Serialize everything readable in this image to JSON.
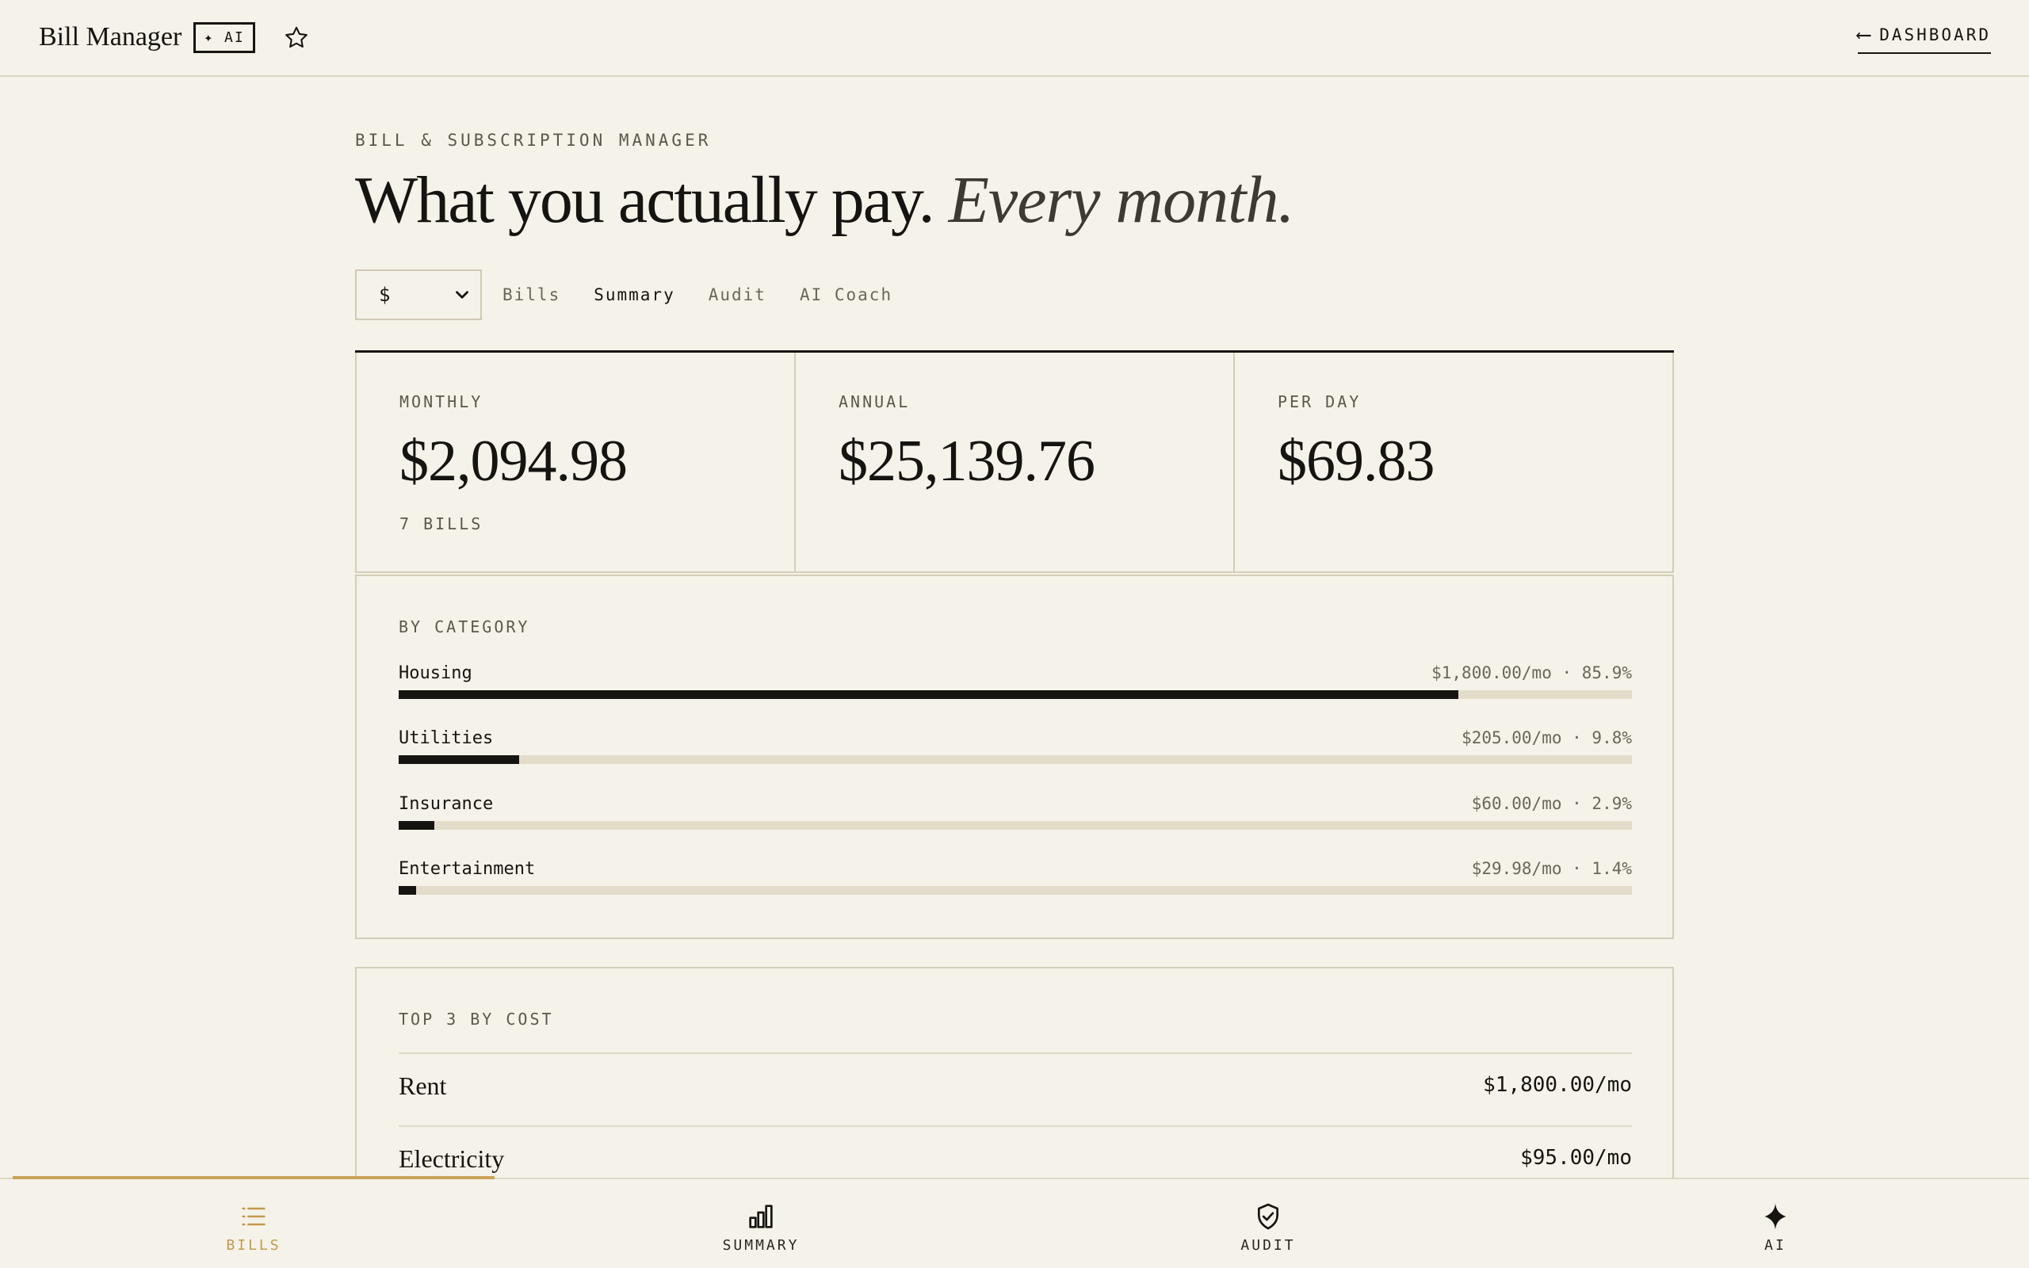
{
  "header": {
    "app_title": "Bill Manager",
    "ai_badge": "✦ AI",
    "dashboard_link": "DASHBOARD",
    "dashboard_arrow": "⟵"
  },
  "hero": {
    "eyebrow": "BILL & SUBSCRIPTION MANAGER",
    "headline_main": "What you actually pay.",
    "headline_italic": "Every month."
  },
  "controls": {
    "currency_selected": "$",
    "tabs": [
      {
        "label": "Bills",
        "active": false
      },
      {
        "label": "Summary",
        "active": true
      },
      {
        "label": "Audit",
        "active": false
      },
      {
        "label": "AI Coach",
        "active": false
      }
    ]
  },
  "stats": {
    "monthly": {
      "label": "MONTHLY",
      "value": "$2,094.98",
      "note": "7 BILLS"
    },
    "annual": {
      "label": "ANNUAL",
      "value": "$25,139.76"
    },
    "per_day": {
      "label": "PER DAY",
      "value": "$69.83"
    }
  },
  "by_category": {
    "label": "BY CATEGORY",
    "items": [
      {
        "name": "Housing",
        "amount": "$1,800.00/mo · 85.9%",
        "percent": 85.9
      },
      {
        "name": "Utilities",
        "amount": "$205.00/mo · 9.8%",
        "percent": 9.8
      },
      {
        "name": "Insurance",
        "amount": "$60.00/mo · 2.9%",
        "percent": 2.9
      },
      {
        "name": "Entertainment",
        "amount": "$29.98/mo · 1.4%",
        "percent": 1.4
      }
    ]
  },
  "top3": {
    "label": "TOP 3 BY COST",
    "items": [
      {
        "name": "Rent",
        "amount": "$1,800.00/mo"
      },
      {
        "name": "Electricity",
        "amount": "$95.00/mo"
      }
    ]
  },
  "bottom_nav": {
    "items": [
      {
        "label": "BILLS",
        "icon": "list-icon",
        "active": true
      },
      {
        "label": "SUMMARY",
        "icon": "bar-chart-icon",
        "active": false
      },
      {
        "label": "AUDIT",
        "icon": "shield-check-icon",
        "active": false
      },
      {
        "label": "AI",
        "icon": "sparkle-icon",
        "active": false
      }
    ]
  },
  "colors": {
    "background": "#f5f2e9",
    "ink": "#161410",
    "accent": "#c9a35a",
    "track": "#e3dccb"
  }
}
